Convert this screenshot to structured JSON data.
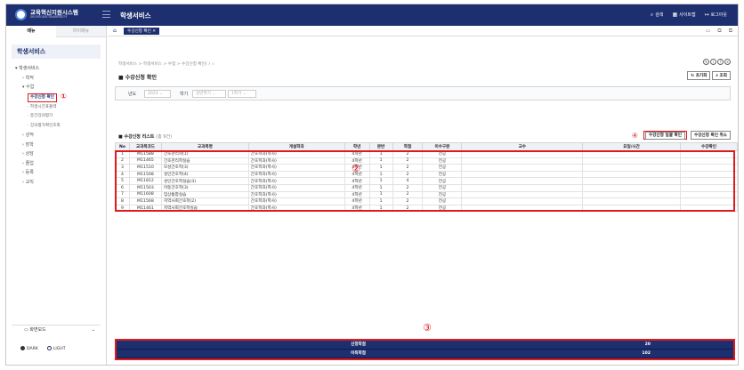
{
  "app": {
    "logo_title": "교육혁신지원시스템",
    "logo_subtitle": "SEOYEONG UNIVERSITY",
    "title": "학생서비스",
    "top_actions": [
      {
        "icon": "search-icon",
        "label": "검색"
      },
      {
        "icon": "sitemap-icon",
        "label": "사이트맵"
      },
      {
        "icon": "logout-icon",
        "label": "로그아웃"
      }
    ]
  },
  "sidebar": {
    "tabs": [
      "메뉴",
      "마이메뉴"
    ],
    "heading": "학생서비스",
    "menu": [
      {
        "label": "학생서비스",
        "level": 1
      },
      {
        "label": "학적",
        "level": 2
      },
      {
        "label": "수업",
        "level": 2
      },
      {
        "label": "수강신청 확인",
        "level": 3,
        "selected": true
      },
      {
        "label": "학생시간표출력",
        "level": 3
      },
      {
        "label": "중간강의평가",
        "level": 3
      },
      {
        "label": "강의평가확인조회",
        "level": 3
      },
      {
        "label": "성적",
        "level": 2
      },
      {
        "label": "장학",
        "level": 2
      },
      {
        "label": "상담",
        "level": 2
      },
      {
        "label": "졸업",
        "level": 2
      },
      {
        "label": "등록",
        "level": 2
      },
      {
        "label": "교직",
        "level": 2
      }
    ],
    "annotation_1": "①",
    "screen_mode_label": "화면모드",
    "theme_dark": "DARK",
    "theme_light": "LIGHT"
  },
  "main": {
    "tab_label": "수강신청 확인",
    "breadcrumb": "학생서비스 > 학생서비스 > 수업 > 수강신청 확인(          ) ☆",
    "page_title": "수강신청 확인",
    "reset_btn": "초기화",
    "search_btn": "조회",
    "filter": {
      "year_label": "년도",
      "year_value": "2023",
      "term_label": "학기",
      "term_value1": "일반학기",
      "term_value2": "1학기"
    },
    "list_title": "수강신청 리스트",
    "list_count": "(총 9건)",
    "annotation_4": "④",
    "bulk_confirm_btn": "수강신청 일괄 확인",
    "cancel_confirm_btn": "수강신청 확인 취소",
    "annotation_2": "②",
    "annotation_3": "③",
    "columns": [
      "No",
      "교과목코드",
      "교과목명",
      "개설학과",
      "학년",
      "분반",
      "학점",
      "이수구분",
      "교수",
      "요일/시간",
      "수강확인"
    ],
    "rows": [
      [
        "1",
        "M11588",
        "간호관리학(1)",
        "간호학과(학사)",
        "4학년",
        "1",
        "2",
        "전공",
        "",
        "",
        ""
      ],
      [
        "2",
        "M11465",
        "간호관리학실습",
        "간호학과(학사)",
        "4학년",
        "1",
        "2",
        "전공",
        "",
        "",
        ""
      ],
      [
        "3",
        "M11510",
        "모성간호학(3)",
        "간호학과(학사)",
        "4학년",
        "1",
        "2",
        "전공",
        "",
        "",
        ""
      ],
      [
        "4",
        "M11508",
        "성인간호학(4)",
        "간호학과(학사)",
        "4학년",
        "1",
        "2",
        "전공",
        "",
        "",
        ""
      ],
      [
        "5",
        "M11812",
        "성인간호학실습(3)",
        "간호학과(학사)",
        "4학년",
        "1",
        "4",
        "전공",
        "",
        "",
        ""
      ],
      [
        "6",
        "M11503",
        "아동간호학(3)",
        "간호학과(학사)",
        "4학년",
        "1",
        "2",
        "전공",
        "",
        "",
        ""
      ],
      [
        "7",
        "M11608",
        "임상통합실습",
        "간호학과(학사)",
        "4학년",
        "1",
        "2",
        "전공",
        "",
        "",
        ""
      ],
      [
        "8",
        "M11568",
        "지역사회간호학(2)",
        "간호학과(학사)",
        "4학년",
        "1",
        "2",
        "전공",
        "",
        "",
        ""
      ],
      [
        "9",
        "M11461",
        "지역사회간호학실습",
        "간호학과(학사)",
        "4학년",
        "1",
        "2",
        "전공",
        "",
        "",
        ""
      ]
    ],
    "summary": [
      {
        "label": "신청학점",
        "value": "20"
      },
      {
        "label": "이득학점",
        "value": "102"
      }
    ]
  },
  "colors": {
    "navy": "#1d2f6f",
    "annotation_red": "#e0191e"
  }
}
